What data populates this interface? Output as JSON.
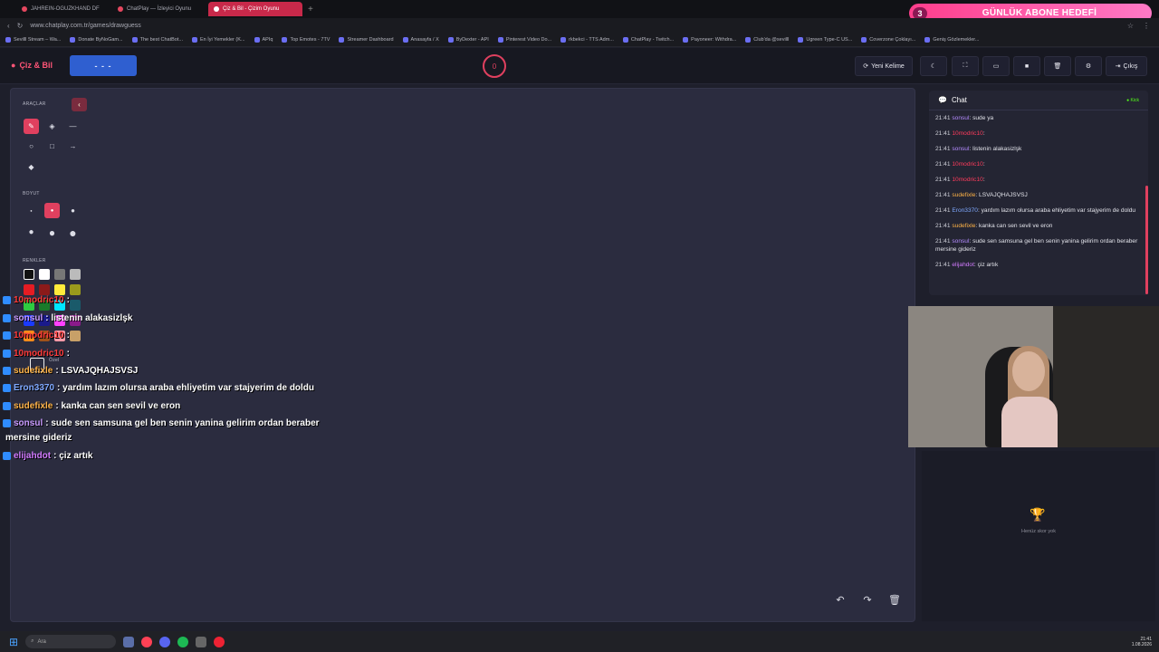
{
  "browser": {
    "tabs": [
      {
        "label": "JAHREIN-OGUZKHAND DF",
        "active": false
      },
      {
        "label": "ChatPlay — İzleyici Oyunu",
        "active": false
      },
      {
        "label": "Çiz & Bil - Çizim Oyunu",
        "active": true
      }
    ],
    "url": "www.chatplay.com.tr/games/drawguess",
    "bookmarks": [
      "Sevilll Stream – Wa...",
      "Donate ByNoGam...",
      "The best ChatBot...",
      "En İyi Yemekler (K...",
      "APIq",
      "Top Emotes - 7TV",
      "Streamer Dashboard",
      "Anasayfa / X",
      "ByDexter - API",
      "Pinterest Video Do...",
      "rkbekci - TTS Adm...",
      "ChatPlay - Twitch...",
      "Payoneer: Withdra...",
      "Club'da @sevilll",
      "Ugreen Type-C US...",
      "Coverzone Çoklayı...",
      "Geniş Gözlemekler..."
    ]
  },
  "banner": {
    "count": "3",
    "text": "GÜNLÜK ABONE HEDEFİ"
  },
  "header": {
    "logo": "Çiz & Bil",
    "word": "- - -",
    "timer": "0",
    "new_word": "Yeni Kelime",
    "exit": "Çıkış"
  },
  "tools": {
    "tools_label": "ARAÇLAR",
    "size_label": "BOYUT",
    "colors_label": "RENKLER",
    "custom_label": "Özel"
  },
  "colors": {
    "accent": "#e0405f",
    "swatches": [
      "#111111",
      "#ffffff",
      "#777777",
      "#bbbbbb",
      "#e51c23",
      "#8b1a1a",
      "#ffeb3b",
      "#9a9a1c",
      "#2ecc40",
      "#1a7a2a",
      "#00e5ff",
      "#1a5a6a",
      "#1a3aff",
      "#1a1a8a",
      "#ff40ff",
      "#8a1a8a",
      "#ff8c1a",
      "#a0521a",
      "#ff9aa8",
      "#c8a068"
    ]
  },
  "overlay": [
    {
      "user": "10modric10",
      "msg": ":",
      "color": "#ff3b3b"
    },
    {
      "user": "sonsul",
      "msg": ": listenin alakasizlşk",
      "color": "#c99bff"
    },
    {
      "user": "10modric10",
      "msg": ":",
      "color": "#ff3b3b"
    },
    {
      "user": "10modric10",
      "msg": ":",
      "color": "#ff3b3b"
    },
    {
      "user": "sudefixle",
      "msg": ": LSVAJQHAJSVSJ",
      "color": "#ffb347"
    },
    {
      "user": "Eron3370",
      "msg": ": yardım lazım olursa araba ehliyetim var stajyerim de doldu",
      "color": "#7fa9ff"
    },
    {
      "user": "sudefixle",
      "msg": ": kanka can sen sevil ve eron",
      "color": "#ffb347"
    },
    {
      "user": "sonsul",
      "msg": ": sude sen samsuna gel ben senin yanina gelirim ordan beraber",
      "color": "#c99bff"
    },
    {
      "user": "",
      "msg": "mersine gideriz",
      "color": "#ffffff"
    },
    {
      "user": "elijahdot",
      "msg": ": çiz artık",
      "color": "#d27bff"
    }
  ],
  "chat": {
    "title": "Chat",
    "platform": "Kick",
    "messages": [
      {
        "time": "21:41",
        "user": "sonsul",
        "msg": ": sude ya",
        "color": "#b48cff"
      },
      {
        "time": "21:41",
        "user": "10modric10",
        "msg": ":",
        "color": "#ff3b5c"
      },
      {
        "time": "21:41",
        "user": "sonsul",
        "msg": ": listenin alakasizlşk",
        "color": "#b48cff"
      },
      {
        "time": "21:41",
        "user": "10modric10",
        "msg": ":",
        "color": "#ff3b5c"
      },
      {
        "time": "21:41",
        "user": "10modric10",
        "msg": ":",
        "color": "#ff3b5c"
      },
      {
        "time": "21:41",
        "user": "sudefixle",
        "msg": ": LSVAJQHAJSVSJ",
        "color": "#ffb347"
      },
      {
        "time": "21:41",
        "user": "Eron3370",
        "msg": ": yardım lazım olursa araba ehliyetim var stajyerim de doldu",
        "color": "#7fa9ff"
      },
      {
        "time": "21:41",
        "user": "sudefixle",
        "msg": ": kanka can sen sevil ve eron",
        "color": "#ffb347"
      },
      {
        "time": "21:41",
        "user": "sonsul",
        "msg": ": sude sen samsuna gel ben senin yanina gelirim ordan beraber mersine gideriz",
        "color": "#b48cff"
      },
      {
        "time": "21:41",
        "user": "elijahdot",
        "msg": ": çiz artık",
        "color": "#d27bff"
      }
    ]
  },
  "leaderboard": {
    "empty": "Henüz skor yok"
  },
  "taskbar": {
    "search": "Ara",
    "time": "21:41",
    "date": "1.08.2026"
  }
}
